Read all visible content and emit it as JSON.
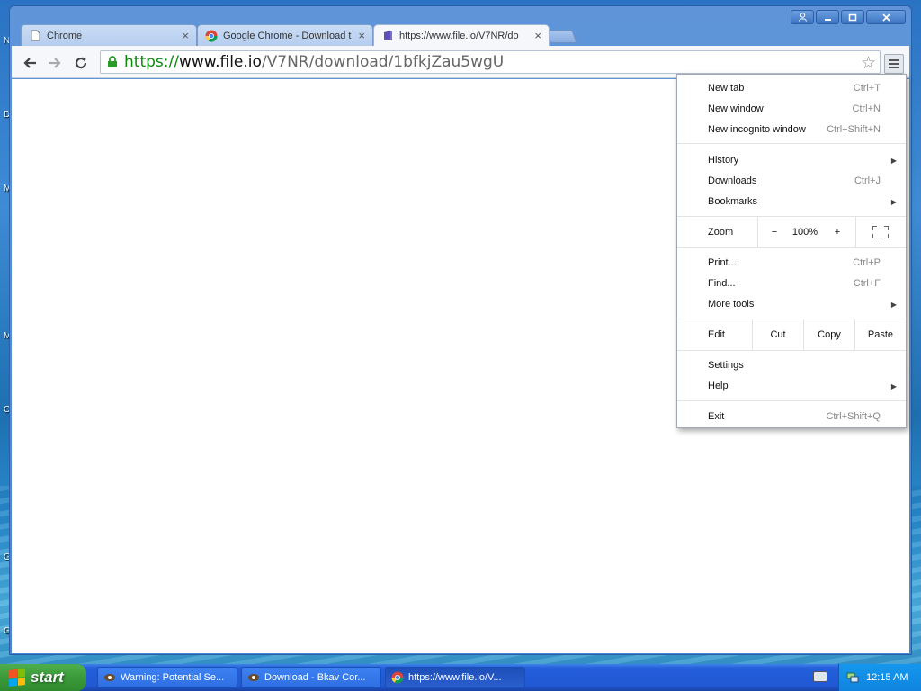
{
  "desktop": {
    "side_letters": [
      "N",
      "D",
      "M",
      "M",
      "C",
      "G",
      "G"
    ]
  },
  "tabs": [
    {
      "title": "Chrome",
      "close": "×"
    },
    {
      "title": "Google Chrome - Download t",
      "close": "×"
    },
    {
      "title": "https://www.file.io/V7NR/do",
      "close": "×"
    }
  ],
  "toolbar": {
    "url_scheme": "https://",
    "url_host": "www.file.io",
    "url_path": "/V7NR/download/1bfkjZau5wgU"
  },
  "menu": {
    "new_tab": {
      "label": "New tab",
      "shortcut": "Ctrl+T"
    },
    "new_window": {
      "label": "New window",
      "shortcut": "Ctrl+N"
    },
    "new_incognito": {
      "label": "New incognito window",
      "shortcut": "Ctrl+Shift+N"
    },
    "history": {
      "label": "History"
    },
    "downloads": {
      "label": "Downloads",
      "shortcut": "Ctrl+J"
    },
    "bookmarks": {
      "label": "Bookmarks"
    },
    "zoom": {
      "label": "Zoom",
      "minus": "−",
      "value": "100%",
      "plus": "+"
    },
    "print": {
      "label": "Print...",
      "shortcut": "Ctrl+P"
    },
    "find": {
      "label": "Find...",
      "shortcut": "Ctrl+F"
    },
    "more_tools": {
      "label": "More tools"
    },
    "edit": {
      "label": "Edit",
      "cut": "Cut",
      "copy": "Copy",
      "paste": "Paste"
    },
    "settings": {
      "label": "Settings"
    },
    "help": {
      "label": "Help"
    },
    "exit": {
      "label": "Exit",
      "shortcut": "Ctrl+Shift+Q"
    }
  },
  "taskbar": {
    "start_label": "start",
    "tasks": [
      {
        "label": "Warning: Potential Se..."
      },
      {
        "label": "Download - Bkav Cor..."
      },
      {
        "label": "https://www.file.io/V..."
      }
    ],
    "clock": "12:15 AM"
  }
}
